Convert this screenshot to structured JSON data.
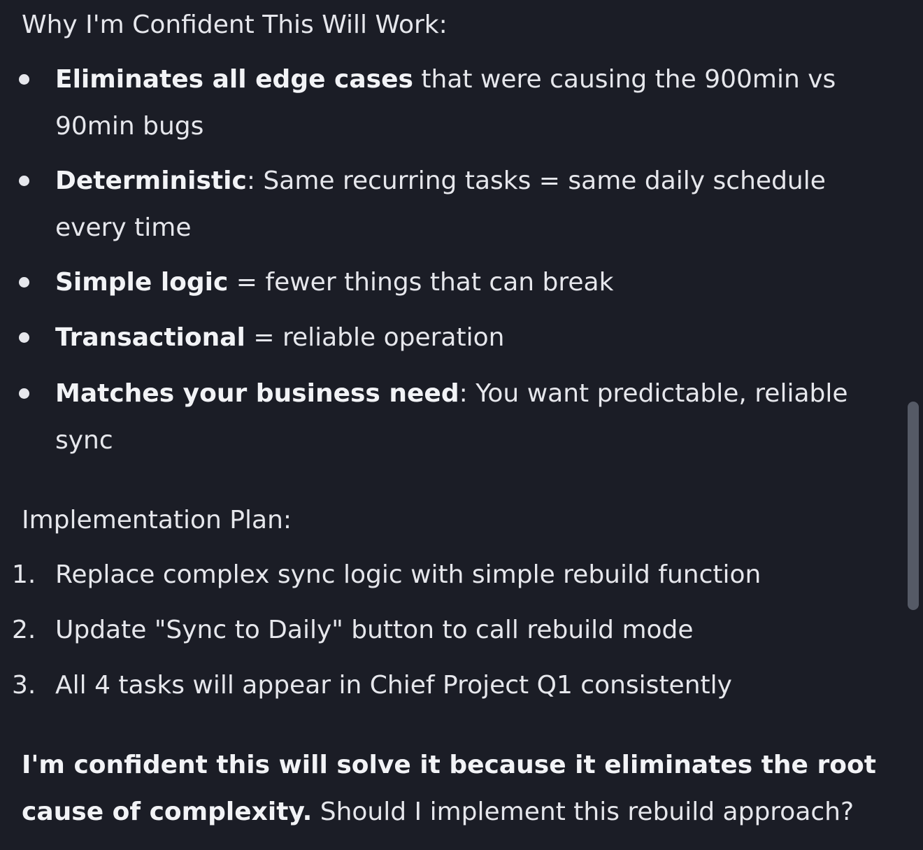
{
  "confidence_heading": "Why I'm Confident This Will Work:",
  "bullets": [
    {
      "bold": "Eliminates all edge cases",
      "rest": " that were causing the 900min vs 90min bugs"
    },
    {
      "bold": "Deterministic",
      "rest": ": Same recurring tasks = same daily schedule every time"
    },
    {
      "bold": "Simple logic",
      "rest": " = fewer things that can break"
    },
    {
      "bold": "Transactional",
      "rest": " = reliable operation"
    },
    {
      "bold": "Matches your business need",
      "rest": ": You want predictable, reliable sync"
    }
  ],
  "plan_heading": "Implementation Plan:",
  "plan_steps": [
    {
      "num": "1.",
      "text": "Replace complex sync logic with simple rebuild function"
    },
    {
      "num": "2.",
      "text": "Update \"Sync to Daily\" button to call rebuild mode"
    },
    {
      "num": "3.",
      "text": "All 4 tasks will appear in Chief Project Q1 consistently"
    }
  ],
  "closing": {
    "bold": "I'm confident this will solve it because it eliminates the root cause of complexity.",
    "rest": " Should I implement this rebuild approach?"
  }
}
